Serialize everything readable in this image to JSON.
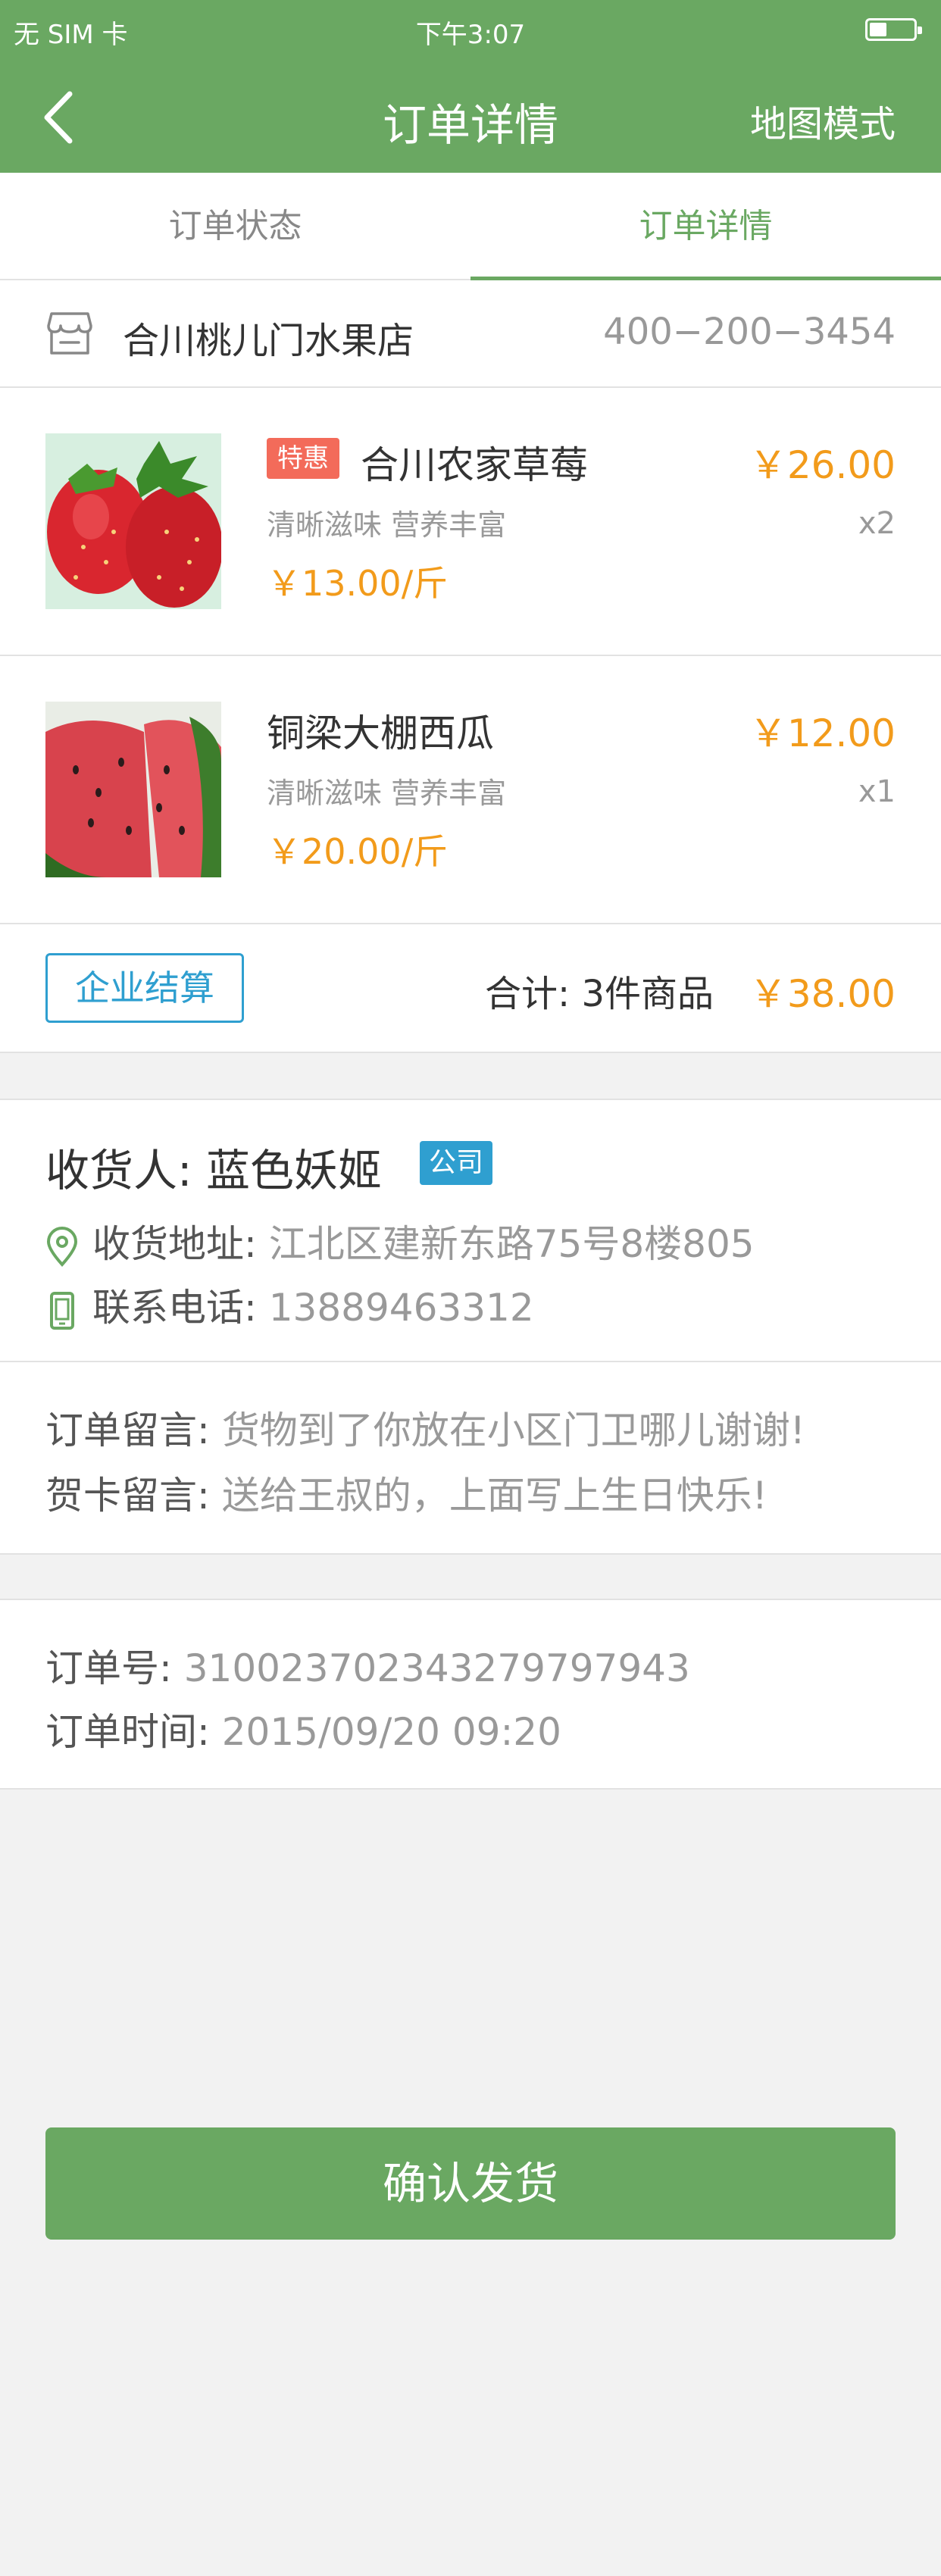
{
  "status_bar": {
    "carrier": "无 SIM 卡",
    "time": "下午3:07"
  },
  "nav": {
    "title": "订单详情",
    "right_action": "地图模式"
  },
  "tabs": [
    {
      "label": "订单状态"
    },
    {
      "label": "订单详情"
    }
  ],
  "store": {
    "name": "合川桃儿门水果店",
    "phone": "400−200−3454"
  },
  "products": [
    {
      "badge": "特惠",
      "name": "合川农家草莓",
      "desc": "清晰滋味 营养丰富",
      "unit_price": "￥13.00/斤",
      "total": "￥26.00",
      "qty": "x2"
    },
    {
      "name": "铜梁大棚西瓜",
      "desc": "清晰滋味 营养丰富",
      "unit_price": "￥20.00/斤",
      "total": "￥12.00",
      "qty": "x1"
    }
  ],
  "summary": {
    "corp_button": "企业结算",
    "count_label": "合计: 3件商品",
    "total": "￥38.00"
  },
  "receiver": {
    "label": "收货人: 蓝色妖姬",
    "tag": "公司",
    "address_key": "收货地址: ",
    "address_value": "江北区建新东路75号8楼805",
    "phone_key": "联系电话: ",
    "phone_value": "13889463312"
  },
  "notes": {
    "order_key": "订单留言: ",
    "order_value": "货物到了你放在小区门卫哪儿谢谢!",
    "card_key": "贺卡留言: ",
    "card_value": "送给王叔的，上面写上生日快乐!"
  },
  "order": {
    "number_key": "订单号: ",
    "number_value": "310023702343279797943",
    "time_key": "订单时间: ",
    "time_value": "2015/09/20  09:20"
  },
  "confirm_button": "确认发货",
  "colors": {
    "primary": "#6aa862",
    "price": "#f29b1b",
    "accent_blue": "#2f9fd0",
    "badge_red": "#f36b5a"
  }
}
